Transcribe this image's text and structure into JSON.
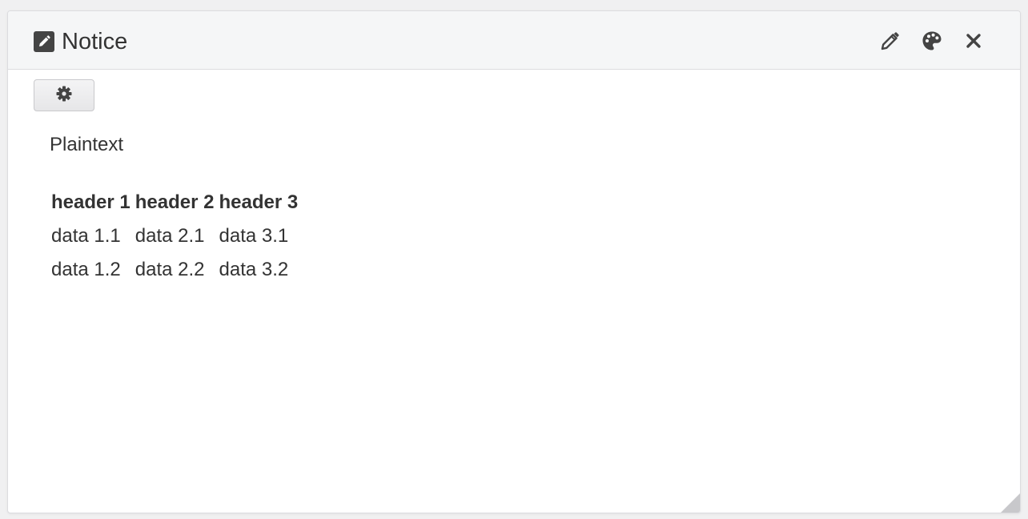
{
  "panel": {
    "title": "Notice",
    "title_icon": "edit-square-icon",
    "actions": [
      {
        "name": "edit",
        "icon": "pencil-icon"
      },
      {
        "name": "theme",
        "icon": "palette-icon"
      },
      {
        "name": "close",
        "icon": "close-icon"
      }
    ]
  },
  "toolbar": {
    "settings_icon": "gear-icon"
  },
  "content": {
    "plaintext": "Plaintext",
    "table": {
      "headers": [
        "header 1",
        "header 2",
        "header 3"
      ],
      "rows": [
        [
          "data 1.1",
          "data 2.1",
          "data 3.1"
        ],
        [
          "data 1.2",
          "data 2.2",
          "data 3.2"
        ]
      ]
    }
  },
  "colors": {
    "icon": "#444444",
    "header_bg": "#f5f6f7",
    "border": "#dcdcdf"
  }
}
